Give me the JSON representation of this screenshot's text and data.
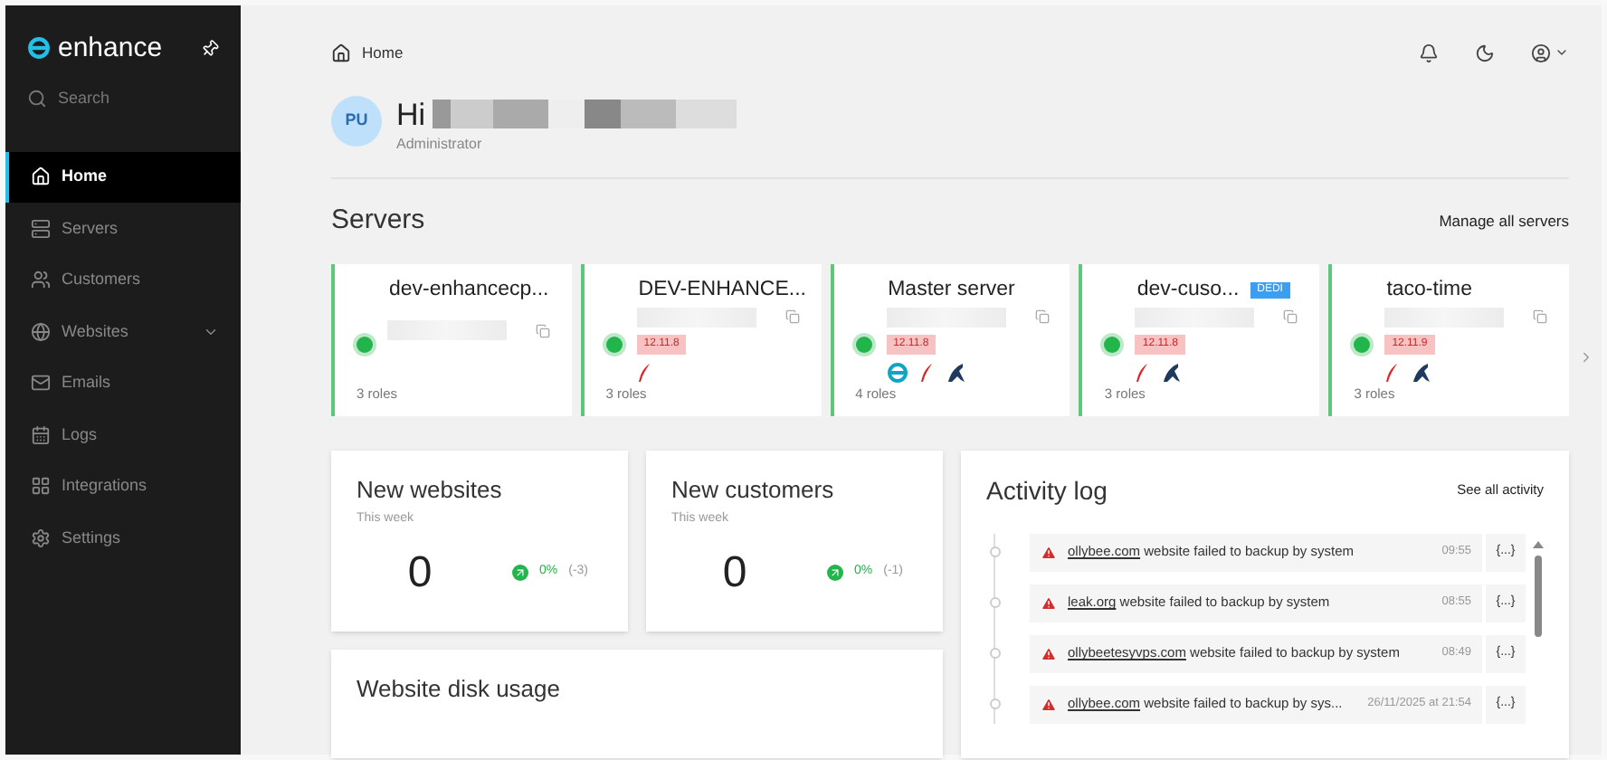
{
  "sidebar": {
    "logo": "enhance",
    "search": {
      "placeholder": "Search"
    },
    "items": [
      {
        "label": "Home",
        "kind": "home",
        "selected": true,
        "expandable": false
      },
      {
        "label": "Servers",
        "kind": "servers",
        "selected": false,
        "expandable": false
      },
      {
        "label": "Customers",
        "kind": "customers",
        "selected": false,
        "expandable": false
      },
      {
        "label": "Websites",
        "kind": "globe",
        "selected": false,
        "expandable": true
      },
      {
        "label": "Emails",
        "kind": "mail",
        "selected": false,
        "expandable": false
      },
      {
        "label": "Logs",
        "kind": "logs",
        "selected": false,
        "expandable": false
      },
      {
        "label": "Integrations",
        "kind": "grid",
        "selected": false,
        "expandable": false
      },
      {
        "label": "Settings",
        "kind": "gear",
        "selected": false,
        "expandable": false
      }
    ]
  },
  "breadcrumb": "Home",
  "user": {
    "initials": "PU",
    "greeting": "Hi",
    "role": "Administrator"
  },
  "servers": {
    "title": "Servers",
    "action": "Manage all servers",
    "items": [
      {
        "name": "dev-enhancecp...",
        "roles_count": "3 roles"
      },
      {
        "name": "DEV-ENHANCE...",
        "version": "12.11.8",
        "roles": [
          {
            "kind": "feather"
          }
        ],
        "roles_count": "3 roles"
      },
      {
        "name": "Master server",
        "version": "12.11.8",
        "roles": [
          {
            "kind": "enhance"
          },
          {
            "kind": "feather"
          },
          {
            "kind": "seal"
          }
        ],
        "roles_count": "4 roles"
      },
      {
        "name": "dev-cuso...",
        "version": "12.11.8",
        "badge": "DEDI",
        "roles": [
          {
            "kind": "feather"
          },
          {
            "kind": "seal"
          }
        ],
        "roles_count": "3 roles"
      },
      {
        "name": "taco-time",
        "version": "12.11.9",
        "roles": [
          {
            "kind": "feather"
          },
          {
            "kind": "seal"
          }
        ],
        "roles_count": "3 roles"
      }
    ]
  },
  "stats": [
    {
      "title": "New websites",
      "period": "This week",
      "value": "0",
      "change": "0%",
      "delta": "(-3)"
    },
    {
      "title": "New customers",
      "period": "This week",
      "value": "0",
      "change": "0%",
      "delta": "(-1)"
    }
  ],
  "disk_usage": {
    "title": "Website disk usage"
  },
  "activity": {
    "title": "Activity log",
    "action": "See all activity",
    "items": [
      {
        "link": "ollybee.com",
        "text": "website failed to backup by system",
        "time": "09:55",
        "details": "{...}"
      },
      {
        "link": "leak.org",
        "text": "website failed to backup by system",
        "time": "08:55",
        "details": "{...}"
      },
      {
        "link": "ollybeetesyvps.com",
        "text": "website failed to backup by system",
        "time": "08:49",
        "details": "{...}"
      },
      {
        "link": "ollybee.com",
        "text": "website failed to backup by sys...",
        "time": "26/11/2025 at 21:54",
        "details": "{...}"
      }
    ]
  }
}
